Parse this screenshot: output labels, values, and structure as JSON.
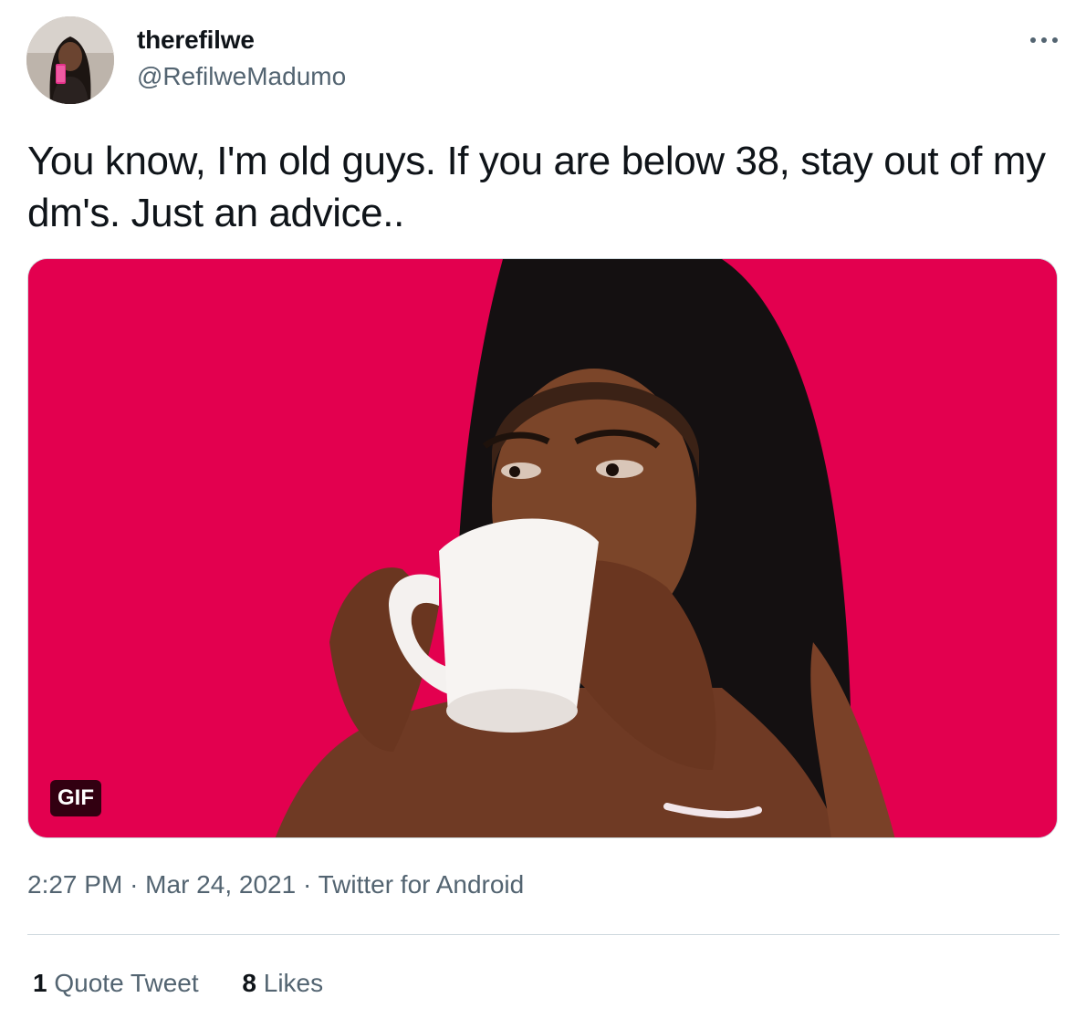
{
  "user": {
    "display_name": "therefilwe",
    "handle": "@RefilweMadumo"
  },
  "tweet": {
    "text": "You know, I'm old guys. If you are below 38, stay out of my dm's. Just an advice..",
    "media_badge": "GIF"
  },
  "meta": {
    "time": "2:27 PM",
    "sep1": "·",
    "date": "Mar 24, 2021",
    "sep2": "·",
    "source": "Twitter for Android"
  },
  "stats": {
    "quote_count": "1",
    "quote_label": "Quote Tweet",
    "like_count": "8",
    "like_label": "Likes"
  },
  "icons": {
    "more": "more-icon"
  },
  "colors": {
    "media_background": "#e3004f",
    "secondary_text": "#536471",
    "primary_text": "#0f1419"
  }
}
